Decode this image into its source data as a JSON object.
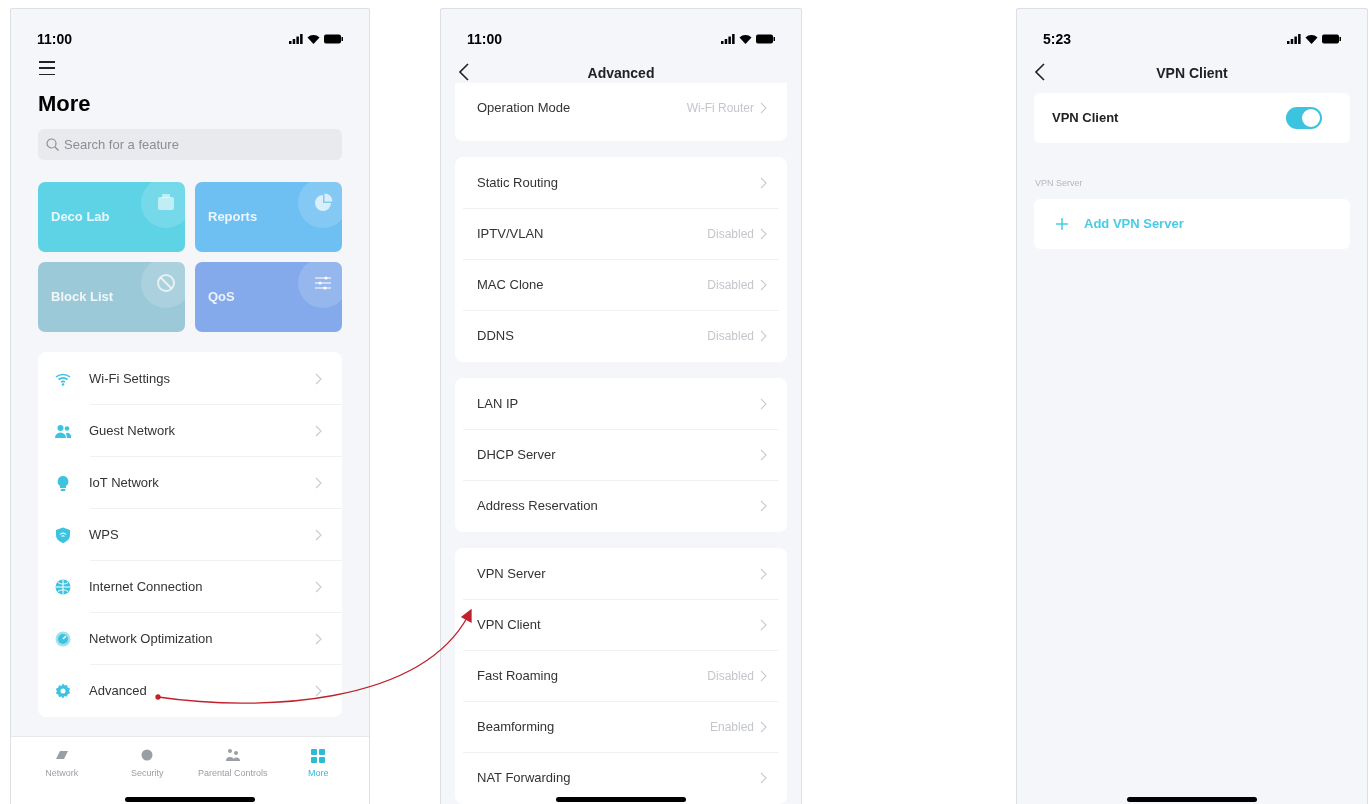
{
  "more_screen": {
    "status_time": "11:00",
    "title": "More",
    "search": {
      "placeholder": "Search for a feature"
    },
    "tiles": [
      {
        "label": "Deco Lab",
        "color": "#5fd3e6"
      },
      {
        "label": "Reports",
        "color": "#6ec0f2"
      },
      {
        "label": "Block List",
        "color": "#9cc9d8"
      },
      {
        "label": "QoS",
        "color": "#84aaec"
      }
    ],
    "menu": [
      {
        "label": "Wi-Fi Settings"
      },
      {
        "label": "Guest Network"
      },
      {
        "label": "IoT Network"
      },
      {
        "label": "WPS"
      },
      {
        "label": "Internet Connection"
      },
      {
        "label": "Network Optimization"
      },
      {
        "label": "Advanced"
      }
    ],
    "tab_bar": [
      {
        "label": "Network",
        "selected": false
      },
      {
        "label": "Security",
        "selected": false
      },
      {
        "label": "Parental Controls",
        "selected": false
      },
      {
        "label": "More",
        "selected": true
      }
    ]
  },
  "advanced_screen": {
    "status_time": "11:00",
    "title": "Advanced",
    "groups": [
      [
        {
          "label": "Operation Mode",
          "value": "Wi-Fi Router"
        }
      ],
      [
        {
          "label": "Static Routing"
        },
        {
          "label": "IPTV/VLAN",
          "value": "Disabled"
        },
        {
          "label": "MAC Clone",
          "value": "Disabled"
        },
        {
          "label": "DDNS",
          "value": "Disabled"
        }
      ],
      [
        {
          "label": "LAN IP"
        },
        {
          "label": "DHCP Server"
        },
        {
          "label": "Address Reservation"
        }
      ],
      [
        {
          "label": "VPN Server"
        },
        {
          "label": "VPN Client"
        },
        {
          "label": "Fast Roaming",
          "value": "Disabled"
        },
        {
          "label": "Beamforming",
          "value": "Enabled"
        },
        {
          "label": "NAT Forwarding"
        }
      ]
    ]
  },
  "vpn_client_screen": {
    "status_time": "5:23",
    "title": "VPN Client",
    "toggle": {
      "label": "VPN Client",
      "on": true
    },
    "section_label": "VPN Server",
    "add_button": "Add VPN Server"
  }
}
